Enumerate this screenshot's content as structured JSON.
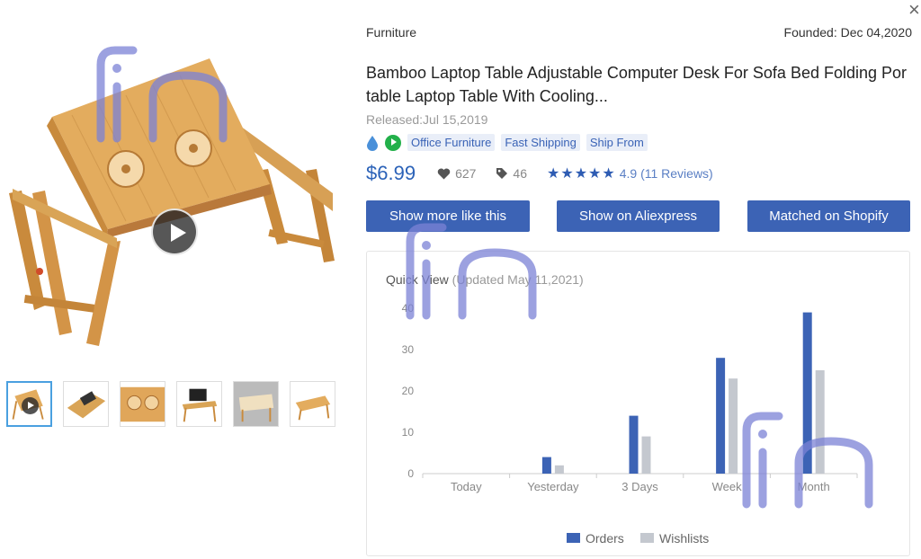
{
  "header": {
    "category": "Furniture",
    "founded": "Founded: Dec 04,2020",
    "close_glyph": "×"
  },
  "product": {
    "title": "Bamboo Laptop Table Adjustable Computer Desk For Sofa Bed Folding Portable Laptop Table With Cooling...",
    "released": "Released:Jul 15,2019",
    "tags": [
      "Office Furniture",
      "Fast Shipping",
      "Ship From"
    ],
    "price": "$6.99",
    "likes": "627",
    "tag_count": "46",
    "stars": "★★★★★",
    "rating": "4.9 (11 Reviews)"
  },
  "buttons": {
    "show_more": "Show more like this",
    "aliexpress": "Show on Aliexpress",
    "shopify": "Matched on Shopify"
  },
  "chart_section": {
    "title": "Quick View",
    "updated": "(Updated May 11,2021)"
  },
  "chart_data": {
    "type": "bar",
    "categories": [
      "Today",
      "Yesterday",
      "3 Days",
      "Week",
      "Month"
    ],
    "series": [
      {
        "name": "Orders",
        "values": [
          0,
          4,
          14,
          28,
          39
        ],
        "color": "#3c63b5"
      },
      {
        "name": "Wishlists",
        "values": [
          0,
          2,
          9,
          23,
          25
        ],
        "color": "#c4c8cf"
      }
    ],
    "ylim": [
      0,
      40
    ],
    "yticks": [
      0,
      10,
      20,
      30,
      40
    ],
    "legend": "bottom-center",
    "grid": false
  },
  "icons": {
    "drop": "drop-icon",
    "play": "play-icon",
    "heart": "heart-icon",
    "tag": "tag-icon",
    "star": "star-icon"
  },
  "colors": {
    "accent": "#3c63b5",
    "price": "#2b62b8",
    "tag_bg": "#e9eef8",
    "green": "#22b04a",
    "watermark": "#7b82d6"
  }
}
